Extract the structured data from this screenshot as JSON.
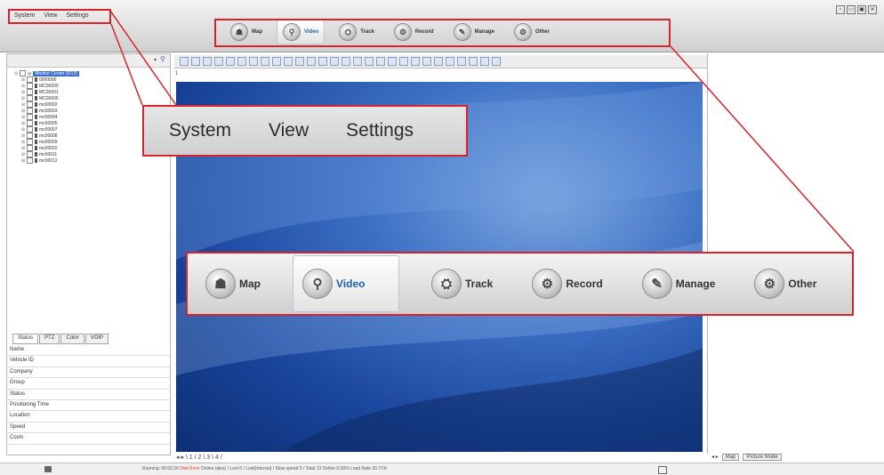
{
  "menu": {
    "system": "System",
    "view": "View",
    "settings": "Settings"
  },
  "window_controls": [
    "▫",
    "▭",
    "▣",
    "✕"
  ],
  "nav": [
    {
      "label": "Map",
      "icon": "map-icon",
      "glyph": "☗",
      "active": false
    },
    {
      "label": "Video",
      "icon": "video-icon",
      "glyph": "⚲",
      "active": true
    },
    {
      "label": "Track",
      "icon": "track-icon",
      "glyph": "⛭",
      "active": false
    },
    {
      "label": "Record",
      "icon": "record-icon",
      "glyph": "⚙",
      "active": false
    },
    {
      "label": "Manage",
      "icon": "manage-icon",
      "glyph": "✎",
      "active": false
    },
    {
      "label": "Other",
      "icon": "other-icon",
      "glyph": "⚙",
      "active": false
    }
  ],
  "tree": {
    "root": "Monitor Center (0/13)",
    "devices": [
      "0000000",
      "MC00000",
      "MC00001",
      "MC00006",
      "mc00002",
      "mc00003",
      "mc00004",
      "mc00005",
      "mc00007",
      "mc00008",
      "mc00009",
      "mc00010",
      "mc00011",
      "mc00012"
    ]
  },
  "info_tabs": [
    "Status",
    "PTZ",
    "Color",
    "VOIP"
  ],
  "info_fields": [
    "Name",
    "Vehicle ID",
    "Company",
    "Group",
    "Status",
    "Positioning Time",
    "Location",
    "Speed",
    "Costs"
  ],
  "video_toolbar_label": "1",
  "page_tabs": "◂ ▸ \\ 1 / 2 \\ 3 \\ 4 /",
  "right_tabs": {
    "nav": "◂ ▸",
    "map": "Map",
    "picture": "Picture Mode"
  },
  "status": {
    "pre": "Running: 00:02:26",
    "red": "Disk Error",
    "rest": "  Online (also) / Lost 0 / Lost(Interval) / Slow speed 0 / Total 13    Online 0.00%  Load Rate 30.71%"
  },
  "colors": {
    "highlight": "#d8232a",
    "active_text": "#1e5fb0",
    "tree_selected": "#3b6cc7"
  }
}
